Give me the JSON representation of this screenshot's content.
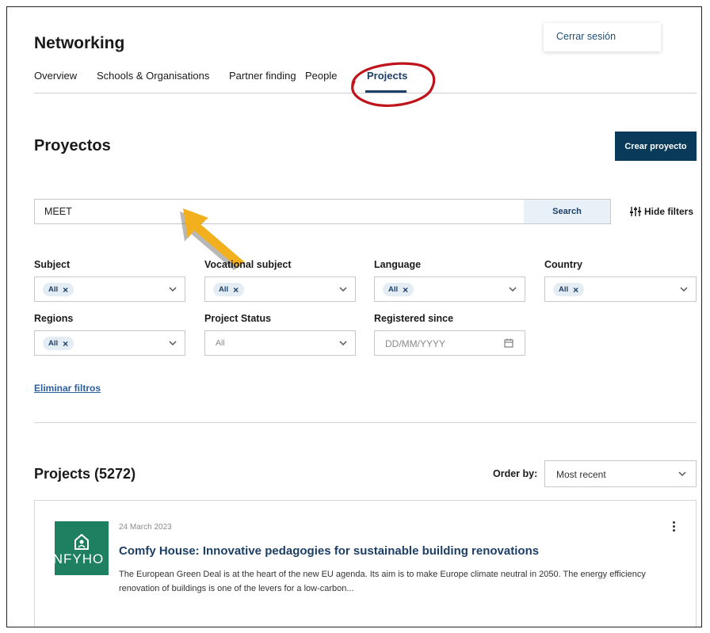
{
  "header": {
    "logout_label": "Cerrar sesión",
    "title": "Networking",
    "tabs": [
      {
        "label": "Overview",
        "active": false
      },
      {
        "label": "Schools & Organisations",
        "active": false
      },
      {
        "label": "Partner finding",
        "active": false
      },
      {
        "label": "People",
        "active": false
      },
      {
        "label": "Projects",
        "active": true
      }
    ]
  },
  "projects_page": {
    "title": "Proyectos",
    "create_button": "Crear proyecto"
  },
  "search": {
    "value": "MEET",
    "button_label": "Search",
    "hide_filters_label": "Hide filters"
  },
  "filters": {
    "subject": {
      "label": "Subject",
      "chip": "All"
    },
    "vocational_subject": {
      "label": "Vocational subject",
      "chip": "All"
    },
    "language": {
      "label": "Language",
      "chip": "All"
    },
    "country": {
      "label": "Country",
      "chip": "All"
    },
    "regions": {
      "label": "Regions",
      "chip": "All"
    },
    "project_status": {
      "label": "Project Status",
      "value": "All"
    },
    "registered_since": {
      "label": "Registered since",
      "placeholder": "DD/MM/YYYY"
    },
    "clear_label": "Eliminar filtros"
  },
  "results": {
    "title": "Projects (5272)",
    "order_label": "Order by:",
    "order_value": "Most recent",
    "items": [
      {
        "date": "24 March 2023",
        "title": "Comfy House: Innovative pedagogies for sustainable building renovations",
        "description": "The European Green Deal is at the heart of the new EU agenda. Its aim is to make Europe climate neutral in 2050. The energy efficiency renovation of buildings is one of the levers for a low-carbon...",
        "logo_text": "INFYHO"
      }
    ]
  },
  "colors": {
    "brand_navy": "#0a3a59",
    "link_blue": "#1d3f66",
    "logo_green": "#1e8061",
    "annotation_red": "#c0141c",
    "annotation_yellow": "#f2b01e"
  }
}
